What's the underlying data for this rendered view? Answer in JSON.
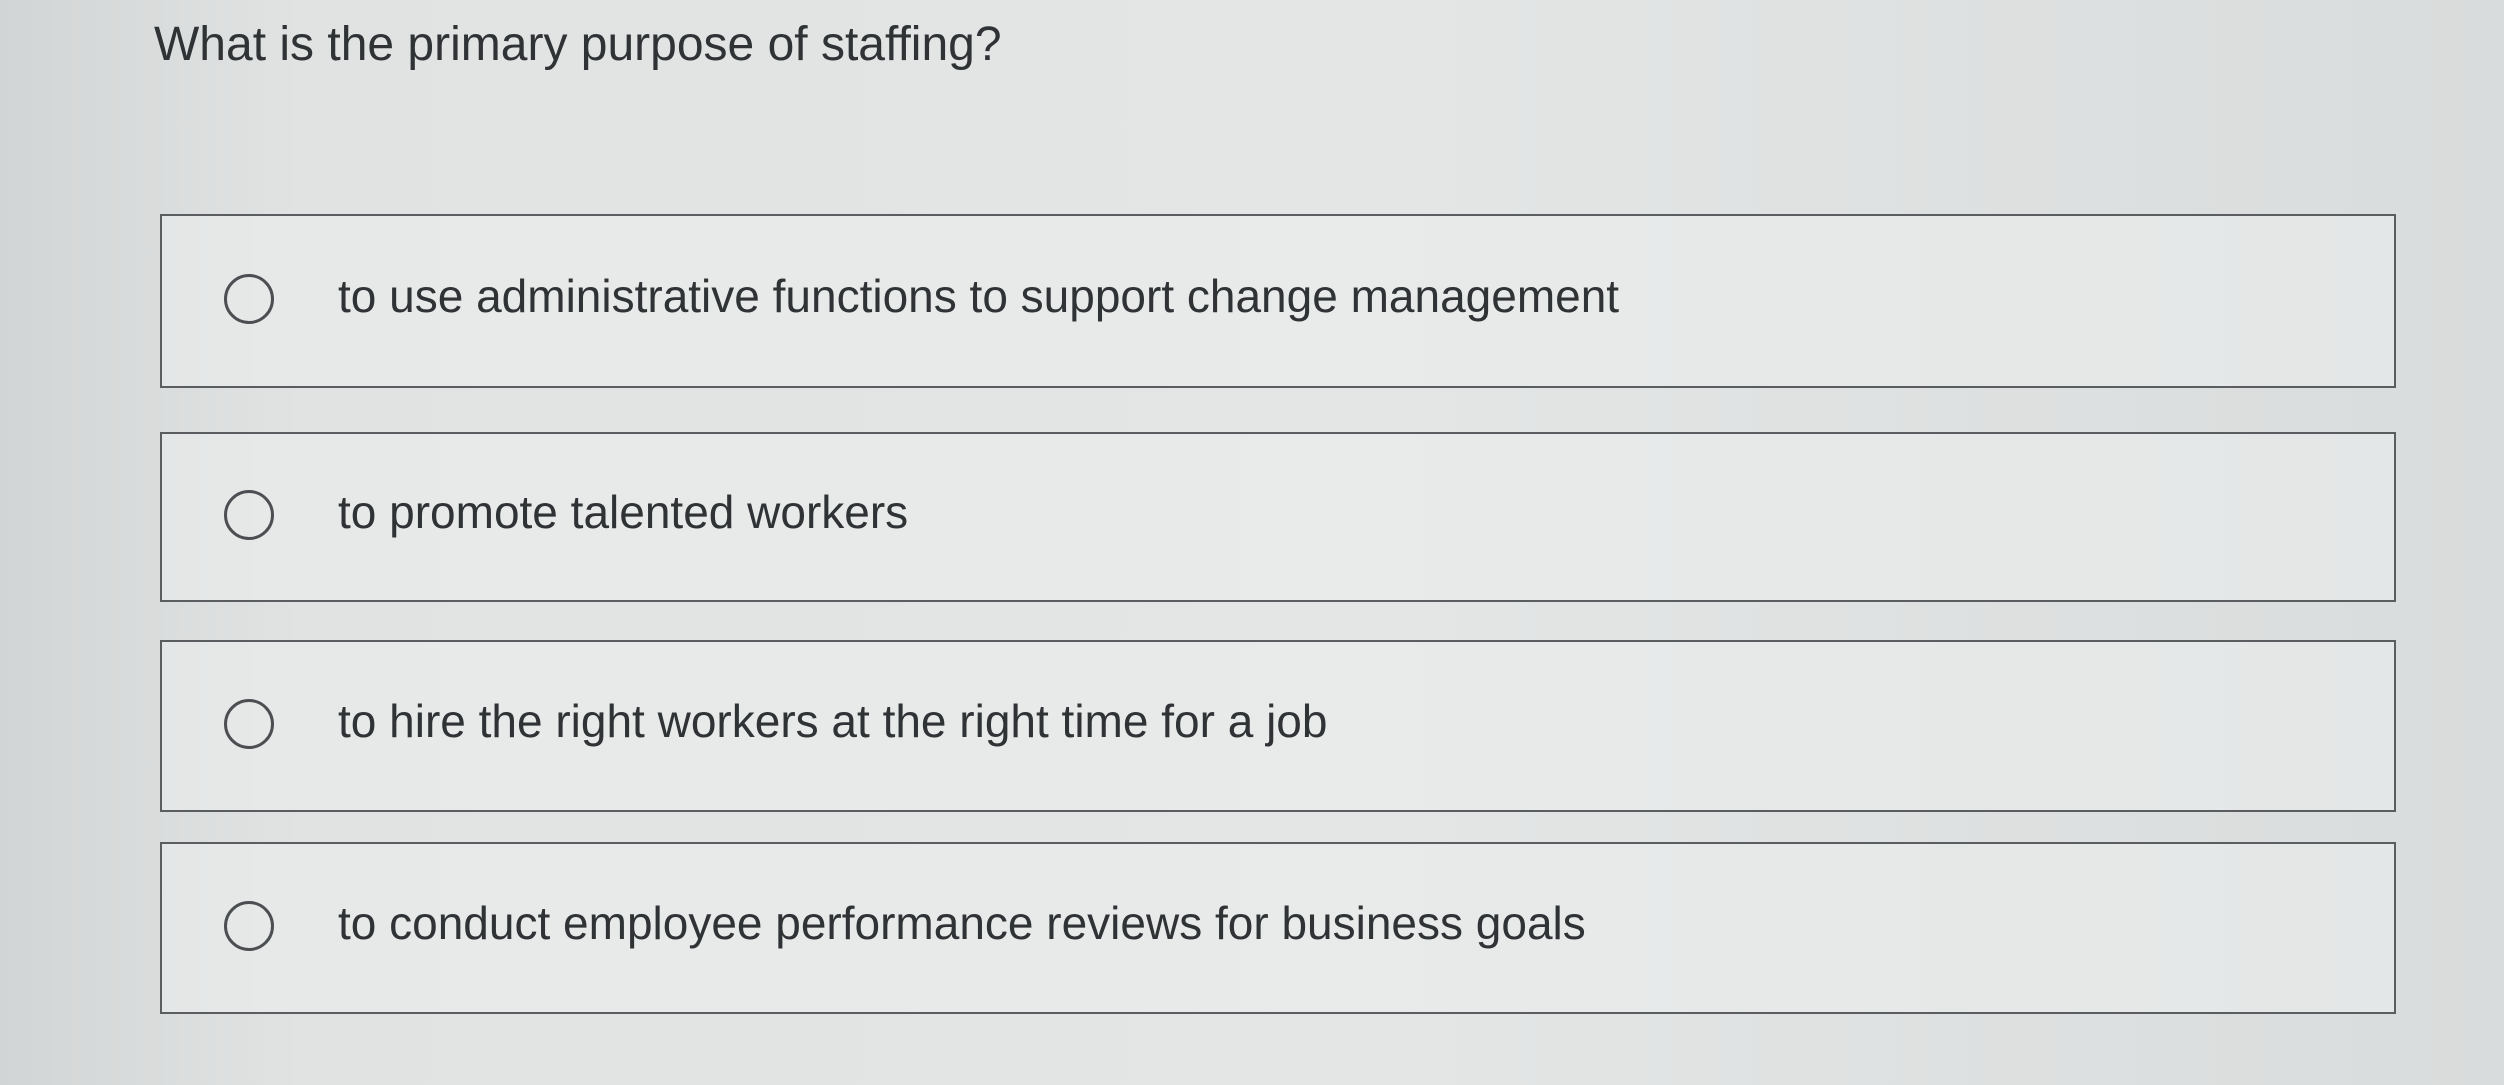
{
  "question": {
    "text": "What is the primary purpose of staffing?"
  },
  "options": [
    {
      "label": "to use administrative functions to support change management",
      "selected": false
    },
    {
      "label": "to promote talented workers",
      "selected": false
    },
    {
      "label": "to hire the right workers at the right time for a job",
      "selected": false
    },
    {
      "label": "to conduct employee performance reviews for business goals",
      "selected": false
    }
  ],
  "colors": {
    "text": "#2f3335",
    "border": "#5a5e60",
    "background": "#dcdfdf"
  }
}
